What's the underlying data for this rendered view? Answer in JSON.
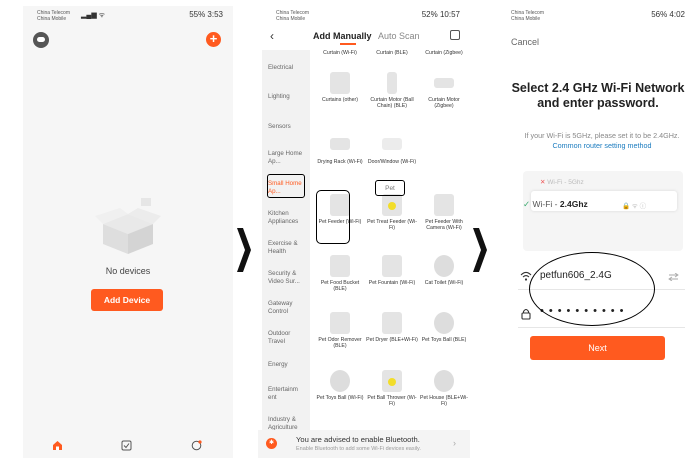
{
  "panel1": {
    "status": {
      "carrier_line1": "China Telecom",
      "carrier_line2": "China Mobile",
      "right": "55% 3:53"
    },
    "empty_text": "No devices",
    "add_button": "Add Device"
  },
  "panel2": {
    "status": {
      "carrier_line1": "China Telecom",
      "carrier_line2": "China Mobile",
      "right": "52% 10:57"
    },
    "tabs": {
      "manual": "Add Manually",
      "auto": "Auto Scan"
    },
    "sidebar": [
      {
        "label": "Electrical"
      },
      {
        "label": "Lighting"
      },
      {
        "label": "Sensors"
      },
      {
        "label": "Large Home Ap..."
      },
      {
        "label": "Small Home Ap..."
      },
      {
        "label": "Kitchen Appliances"
      },
      {
        "label": "Exercise & Health"
      },
      {
        "label": "Security & Video Sur..."
      },
      {
        "label": "Gateway Control"
      },
      {
        "label": "Outdoor Travel"
      },
      {
        "label": "Energy"
      },
      {
        "label": "Entertainm ent"
      },
      {
        "label": "Industry & Agriculture"
      }
    ],
    "top_row": [
      {
        "label": "Curtain (Wi-Fi)"
      },
      {
        "label": "Curtain (BLE)"
      },
      {
        "label": "Curtain (Zigbee)"
      }
    ],
    "curtain_row2": [
      {
        "label": "Curtains (other)"
      },
      {
        "label": "Curtain Motor (Ball Chain) (BLE)"
      },
      {
        "label": "Curtain Motor (Zigbee)"
      }
    ],
    "small_row": [
      {
        "label": "Drying Rack (Wi-Fi)"
      },
      {
        "label": "Door/Window (Wi-Fi)"
      }
    ],
    "pet_heading": "Pet",
    "pet_items": [
      {
        "label": "Pet Feeder (Wi-Fi)"
      },
      {
        "label": "Pet Treat Feeder (Wi-Fi)"
      },
      {
        "label": "Pet Feeder With Camera (Wi-Fi)"
      },
      {
        "label": "Pet Food Bucket (BLE)"
      },
      {
        "label": "Pet Fountain (Wi-Fi)"
      },
      {
        "label": "Cat Toilet (Wi-Fi)"
      },
      {
        "label": "Pet Odor Remover (BLE)"
      },
      {
        "label": "Pet Dryer (BLE+Wi-Fi)"
      },
      {
        "label": "Pet Toys Ball (BLE)"
      },
      {
        "label": "Pet Toys Ball (Wi-Fi)"
      },
      {
        "label": "Pet Ball Thrower (Wi-Fi)"
      },
      {
        "label": "Pet House (BLE+Wi-Fi)"
      }
    ],
    "bluetooth": {
      "title": "You are advised to enable Bluetooth.",
      "subtitle": "Enable Bluetooth to add some Wi-Fi devices easily."
    }
  },
  "panel3": {
    "status": {
      "carrier_line1": "China Telecom",
      "carrier_line2": "China Mobile",
      "right": "56% 4:02"
    },
    "cancel": "Cancel",
    "title": "Select 2.4 GHz Wi-Fi Network and enter password.",
    "subtitle": "If your Wi-Fi is 5GHz, please set it to be 2.4GHz.",
    "subtitle_link": "Common router setting method",
    "wifi_5g": "Wi-Fi - 5Ghz",
    "wifi_24g_prefix": "Wi-Fi - ",
    "wifi_24g_band": "2.4Ghz",
    "ssid": "petfun606_2.4G",
    "password_mask": "••••••••••",
    "next": "Next"
  }
}
